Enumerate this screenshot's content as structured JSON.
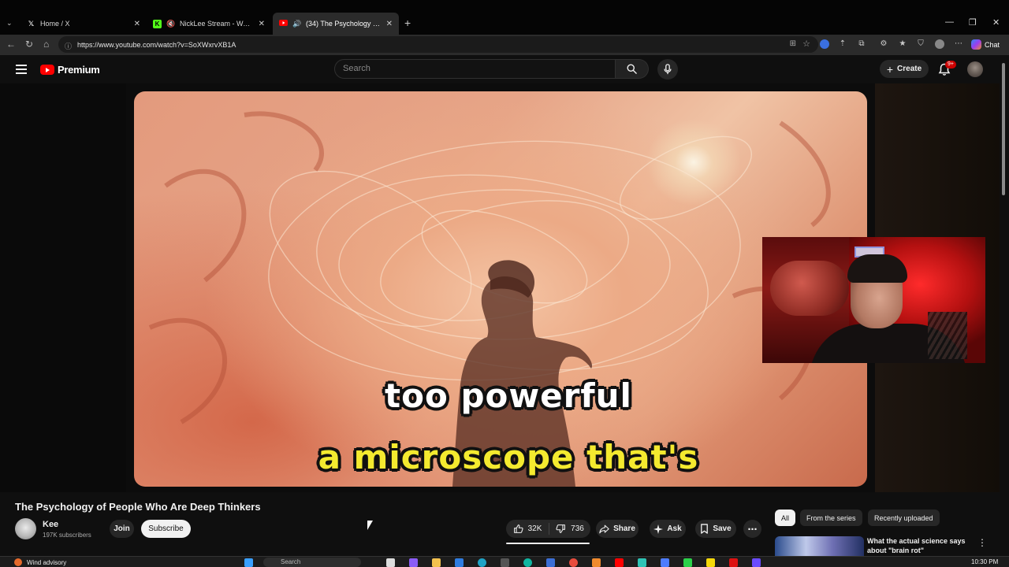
{
  "browser": {
    "tabs": [
      {
        "label": "Home / X",
        "icon": "x-logo-icon"
      },
      {
        "label": "NickLee Stream - Watch Live o",
        "icon": "kick-logo-icon"
      },
      {
        "label": "(34) The Psychology of People",
        "icon": "youtube-logo-icon"
      }
    ],
    "url": "https://www.youtube.com/watch?v=SoXWxrvXB1A",
    "chat_label": "Chat"
  },
  "youtube": {
    "brand": "Premium",
    "search_placeholder": "Search",
    "create_label": "Create",
    "notification_badge": "9+"
  },
  "video": {
    "subtitle_line1": "too powerful",
    "subtitle_line2": "a microscope that's"
  },
  "meta": {
    "title": "The Psychology of People Who Are Deep Thinkers",
    "channel": "Kee",
    "subscribers": "197K subscribers",
    "join_label": "Join",
    "subscribe_label": "Subscribe",
    "likes": "32K",
    "dislikes": "736",
    "share_label": "Share",
    "ask_label": "Ask",
    "save_label": "Save"
  },
  "sidebar": {
    "chips": [
      "All",
      "From the series",
      "Recently uploaded"
    ],
    "active_chip": "All",
    "rec_title": "What the actual science says about \"brain rot\""
  },
  "taskbar": {
    "weather": "Wind advisory",
    "search_placeholder": "Search",
    "clock": "10:30 PM"
  },
  "colors": {
    "yt_red": "#ff0000",
    "background": "#0f0f0f",
    "subtitle_yellow": "#f4ea2f"
  }
}
